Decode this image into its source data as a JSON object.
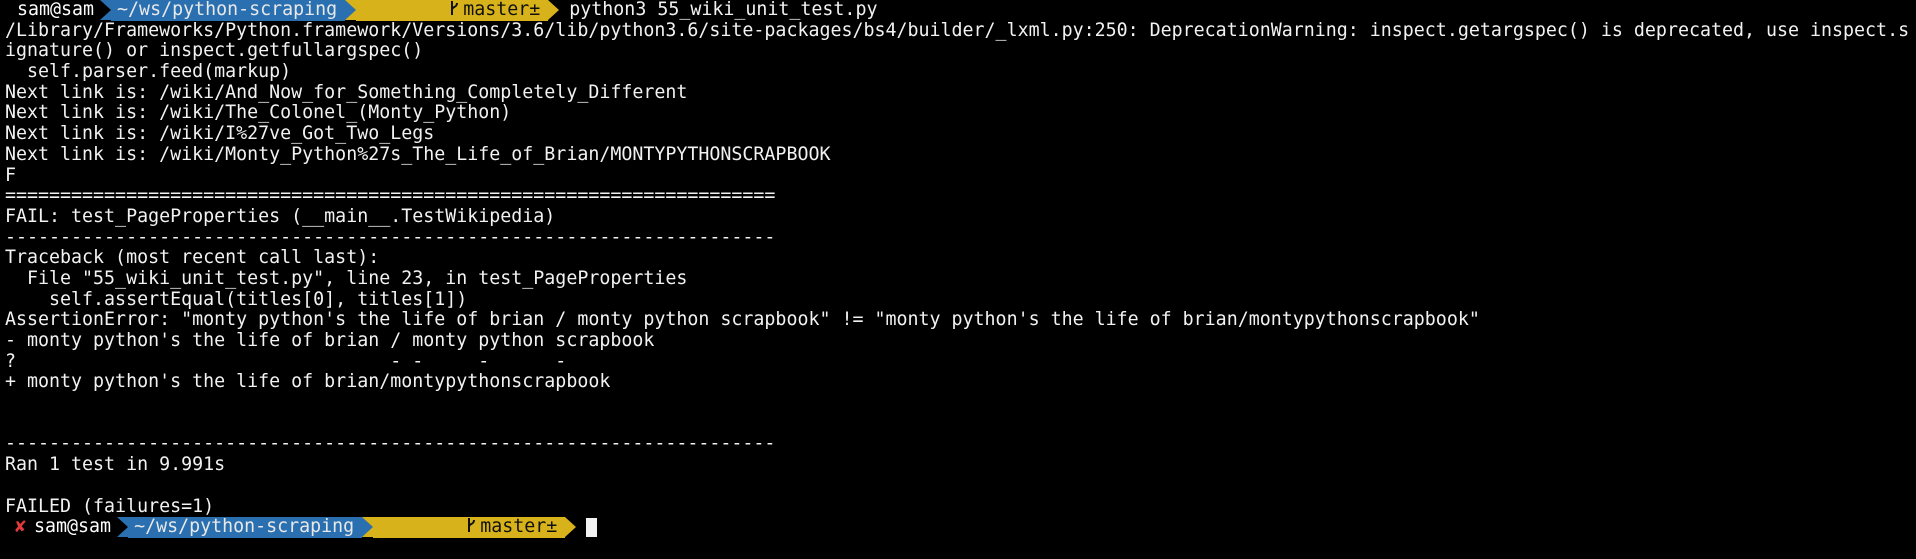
{
  "prompt1": {
    "user": "sam@sam",
    "dir": "~/ws/python-scraping",
    "branch": "master±",
    "command": "python3 55_wiki_unit_test.py"
  },
  "output_lines": [
    "/Library/Frameworks/Python.framework/Versions/3.6/lib/python3.6/site-packages/bs4/builder/_lxml.py:250: DeprecationWarning: inspect.getargspec() is deprecated, use inspect.s",
    "ignature() or inspect.getfullargspec()",
    "  self.parser.feed(markup)",
    "Next link is: /wiki/And_Now_for_Something_Completely_Different",
    "Next link is: /wiki/The_Colonel_(Monty_Python)",
    "Next link is: /wiki/I%27ve_Got_Two_Legs",
    "Next link is: /wiki/Monty_Python%27s_The_Life_of_Brian/MONTYPYTHONSCRAPBOOK",
    "F",
    "======================================================================",
    "FAIL: test_PageProperties (__main__.TestWikipedia)",
    "----------------------------------------------------------------------",
    "Traceback (most recent call last):",
    "  File \"55_wiki_unit_test.py\", line 23, in test_PageProperties",
    "    self.assertEqual(titles[0], titles[1])",
    "AssertionError: \"monty python's the life of brian / monty python scrapbook\" != \"monty python's the life of brian/montypythonscrapbook\"",
    "- monty python's the life of brian / monty python scrapbook",
    "?                                  - -     -      -",
    "+ monty python's the life of brian/montypythonscrapbook",
    "",
    "",
    "----------------------------------------------------------------------",
    "Ran 1 test in 9.991s",
    "",
    "FAILED (failures=1)"
  ],
  "prompt2": {
    "error_mark": "✘",
    "user": "sam@sam",
    "dir": "~/ws/python-scraping",
    "branch": "master±"
  },
  "icons": {
    "branch": "branch-icon",
    "error": "error-x-icon",
    "separator": "powerline-arrow-icon"
  },
  "colors": {
    "background": "#000000",
    "text": "#f2f2f2",
    "dir_segment": "#2a6fb0",
    "git_segment": "#d8b21a",
    "error_mark": "#e03a3a"
  }
}
